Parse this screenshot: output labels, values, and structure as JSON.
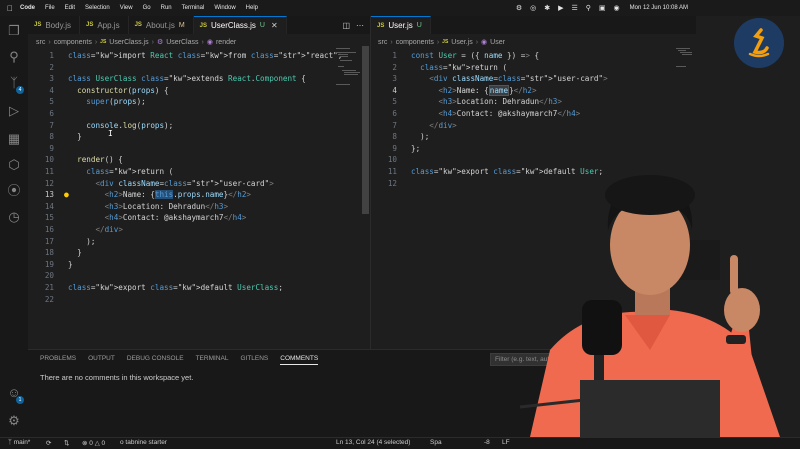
{
  "menubar": {
    "apple_icon": "apple-icon",
    "items": [
      "Code",
      "File",
      "Edit",
      "Selection",
      "View",
      "Go",
      "Run",
      "Terminal",
      "Window",
      "Help"
    ],
    "clock": "Mon 12 Jun  10:08 AM"
  },
  "activity_badges": {
    "source_control": "4",
    "accounts": "1"
  },
  "tabs_left": [
    {
      "label": "Body.js",
      "modified": ""
    },
    {
      "label": "App.js",
      "modified": ""
    },
    {
      "label": "About.js",
      "modified": "M"
    },
    {
      "label": "UserClass.js",
      "modified": "U",
      "active": true
    }
  ],
  "tabs_right": [
    {
      "label": "User.js",
      "modified": "U",
      "active": true
    }
  ],
  "breadcrumb_left": [
    "src",
    "components",
    "UserClass.js",
    "UserClass",
    "render"
  ],
  "breadcrumb_right": [
    "src",
    "components",
    "User.js",
    "User"
  ],
  "editor_left": {
    "current_line": 13,
    "lines": [
      "import React from \"react\";",
      "",
      "class UserClass extends React.Component {",
      "  constructor(props) {",
      "    super(props);",
      "",
      "    console.log(props);",
      "  }",
      "",
      "  render() {",
      "    return (",
      "      <div className=\"user-card\">",
      "        <h2>Name: {this.props.name}</h2>",
      "        <h3>Location: Dehradun</h3>",
      "        <h4>Contact: @akshaymarch7</h4>",
      "      </div>",
      "    );",
      "  }",
      "}",
      "",
      "export default UserClass;",
      ""
    ]
  },
  "editor_right": {
    "current_line": 4,
    "lines": [
      "const User = ({ name }) => {",
      "  return (",
      "    <div className=\"user-card\">",
      "      <h2>Name: {name}</h2>",
      "      <h3>Location: Dehradun</h3>",
      "      <h4>Contact: @akshaymarch7</h4>",
      "    </div>",
      "  );",
      "};",
      "",
      "export default User;",
      ""
    ]
  },
  "panel": {
    "tabs": [
      "PROBLEMS",
      "OUTPUT",
      "DEBUG CONSOLE",
      "TERMINAL",
      "GITLENS",
      "COMMENTS"
    ],
    "active_tab": "COMMENTS",
    "filter_placeholder": "Filter (e.g. text, autho",
    "message": "There are no comments in this workspace yet."
  },
  "status": {
    "branch": "main*",
    "sync_icon": "sync-icon",
    "problems": "0",
    "warnings": "0",
    "tabnine": "tabnine starter",
    "position": "Ln 13, Col 24 (4 selected)",
    "spaces": "Spa",
    "encoding": "-8",
    "eol": "LF"
  },
  "colors": {
    "accent": "#0078d4",
    "editor_bg": "#1e1e1e",
    "keyword": "#c586c0",
    "function": "#dcdcaa",
    "string": "#ce9178"
  }
}
